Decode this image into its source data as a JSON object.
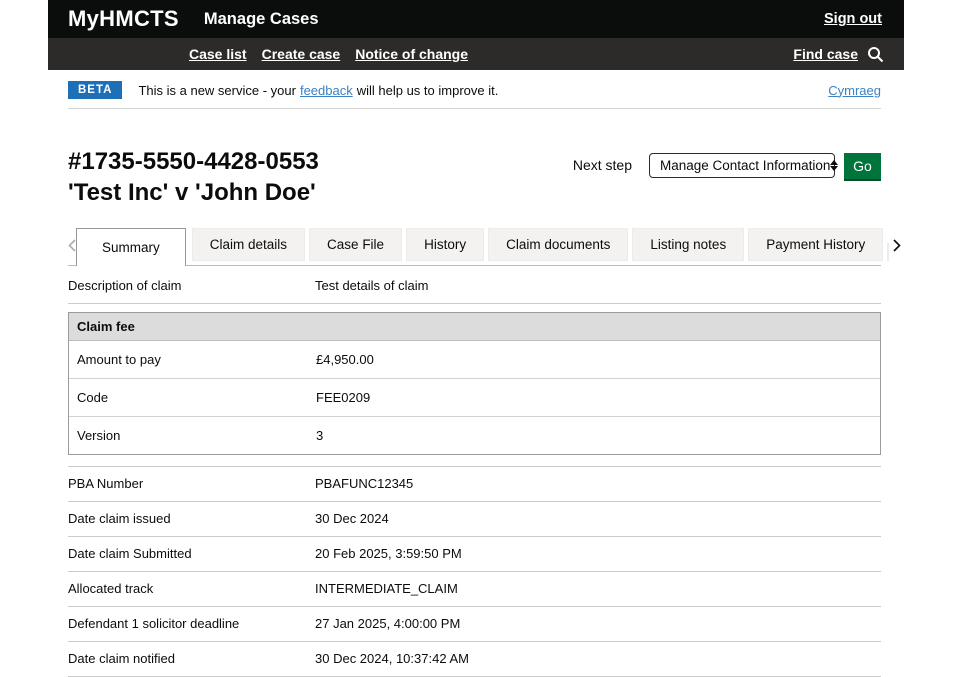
{
  "colors": {
    "header_bg": "#0b0c0c",
    "nav_bg": "#2c2b29",
    "beta_badge_bg": "#1d70b8",
    "link_blue": "#3b82c4",
    "go_green": "#00753b",
    "tab_inactive_bg": "#f3f2f1",
    "panel_header_bg": "#dcdcdc"
  },
  "header": {
    "logo": "MyHMCTS",
    "app_title": "Manage Cases",
    "sign_out": "Sign out",
    "nav_items": [
      {
        "label": "Case list"
      },
      {
        "label": "Create case"
      },
      {
        "label": "Notice of change"
      }
    ],
    "find_case": "Find case",
    "search_icon": "magnifying-glass"
  },
  "beta_bar": {
    "badge": "BETA",
    "text_before": "This is a new service - your",
    "feedback_link": "feedback",
    "text_after": "will help us to improve it.",
    "language_link": "Cymraeg"
  },
  "case_header": {
    "reference": "#1735-5550-4428-0553",
    "parties": "'Test Inc' v 'John Doe'"
  },
  "next_step": {
    "label": "Next step",
    "selected_option": "Manage Contact Information",
    "go_label": "Go"
  },
  "tabs": [
    {
      "label": "Summary",
      "active": true
    },
    {
      "label": "Claim details",
      "active": false
    },
    {
      "label": "Case File",
      "active": false
    },
    {
      "label": "History",
      "active": false
    },
    {
      "label": "Claim documents",
      "active": false
    },
    {
      "label": "Listing notes",
      "active": false
    },
    {
      "label": "Payment History",
      "active": false
    }
  ],
  "summary": {
    "rows_top": [
      {
        "label": "Description of claim",
        "value": "Test details of claim"
      }
    ],
    "claim_fee": {
      "title": "Claim fee",
      "rows": [
        {
          "label": "Amount to pay",
          "value": "£4,950.00"
        },
        {
          "label": "Code",
          "value": "FEE0209"
        },
        {
          "label": "Version",
          "value": "3"
        }
      ]
    },
    "rows_bottom": [
      {
        "label": "PBA Number",
        "value": "PBAFUNC12345"
      },
      {
        "label": "Date claim issued",
        "value": "30 Dec 2024"
      },
      {
        "label": "Date claim Submitted",
        "value": "20 Feb 2025, 3:59:50 PM"
      },
      {
        "label": "Allocated track",
        "value": "INTERMEDIATE_CLAIM"
      },
      {
        "label": "Defendant 1 solicitor deadline",
        "value": "27 Jan 2025, 4:00:00 PM"
      },
      {
        "label": "Date claim notified",
        "value": "30 Dec 2024, 10:37:42 AM"
      }
    ]
  }
}
